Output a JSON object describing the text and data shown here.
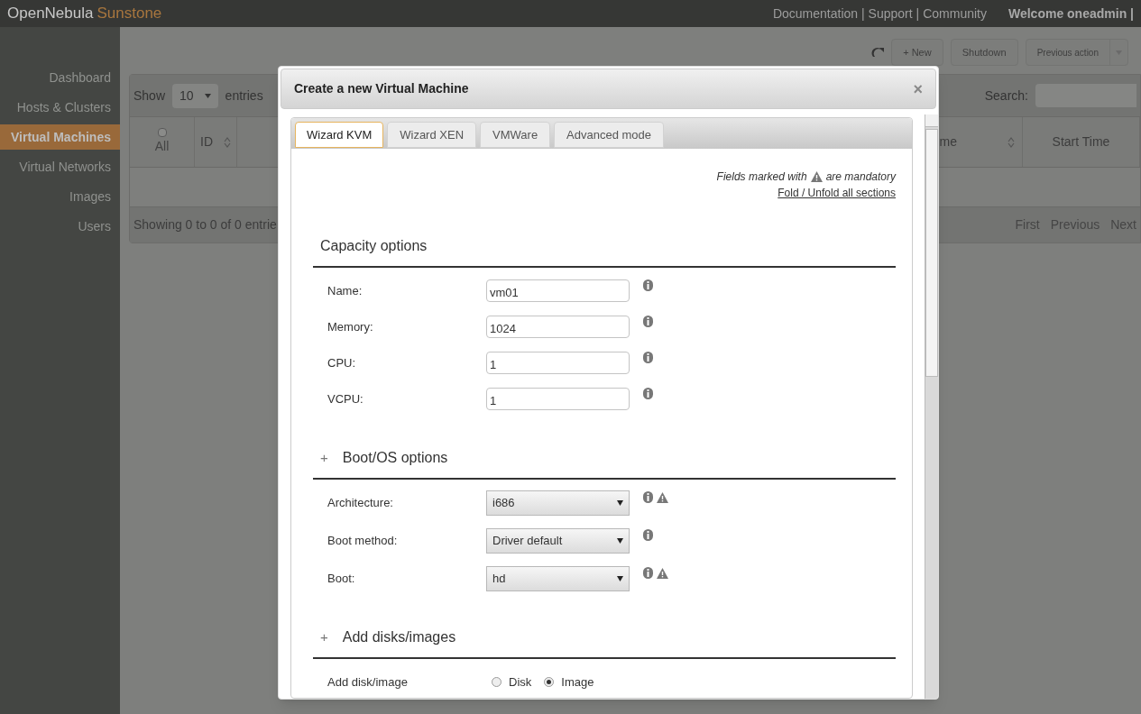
{
  "header": {
    "brand": "OpenNebula",
    "product": "Sunstone",
    "links": [
      "Documentation |",
      "Support |",
      "Community"
    ],
    "welcome": "Welcome oneadmin |"
  },
  "sidebar": {
    "items": [
      {
        "label": "Dashboard",
        "selected": false
      },
      {
        "label": "Hosts & Clusters",
        "selected": false
      },
      {
        "label": "Virtual Machines",
        "selected": true
      },
      {
        "label": "Virtual Networks",
        "selected": false
      },
      {
        "label": "Images",
        "selected": false
      },
      {
        "label": "Users",
        "selected": false
      }
    ]
  },
  "toolbar": {
    "buttons": [
      {
        "label": "+ New",
        "kind": "button"
      },
      {
        "label": "Shutdown",
        "kind": "button"
      },
      {
        "label": "Previous action",
        "kind": "split"
      }
    ]
  },
  "table": {
    "show_label": "Show",
    "length": "10",
    "entries_label": "entries",
    "search_label": "Search:",
    "columns": [
      {
        "label": "All",
        "kind": "checkbox",
        "sortable": false,
        "checked": false
      },
      {
        "label": "ID",
        "kind": "text",
        "sortable": true
      },
      {
        "label": "me",
        "kind": "text",
        "sortable": true
      },
      {
        "label": "Start Time",
        "kind": "text",
        "sortable": false
      }
    ],
    "info": "Showing 0 to 0 of 0 entrie",
    "pagination": [
      "First",
      "Previous",
      "Next"
    ]
  },
  "dialog": {
    "title": "Create a new Virtual Machine",
    "close": "×",
    "tabs": [
      {
        "label": "Wizard KVM",
        "selected": true
      },
      {
        "label": "Wizard XEN",
        "selected": false
      },
      {
        "label": "VMWare",
        "selected": false
      },
      {
        "label": "Advanced mode",
        "selected": false
      }
    ],
    "note_before": "Fields marked with",
    "note_after": "are mandatory",
    "fold_link": "Fold / Unfold all sections",
    "sections": [
      {
        "title": "Capacity options",
        "fields": [
          {
            "kind": "text",
            "label": "Name:",
            "value": "vm01",
            "mandatory": false
          },
          {
            "kind": "text",
            "label": "Memory:",
            "value": "1024",
            "mandatory": false
          },
          {
            "kind": "text",
            "label": "CPU:",
            "value": "1",
            "mandatory": false
          },
          {
            "kind": "text",
            "label": "VCPU:",
            "value": "1",
            "mandatory": false
          }
        ]
      },
      {
        "toggle": "+",
        "title": "Boot/OS options",
        "fields": [
          {
            "kind": "select",
            "label": "Architecture:",
            "value": "i686",
            "mandatory": true
          },
          {
            "kind": "select",
            "label": "Boot method:",
            "value": "Driver default",
            "mandatory": false
          },
          {
            "kind": "select",
            "label": "Boot:",
            "value": "hd",
            "mandatory": true
          }
        ]
      },
      {
        "toggle": "+",
        "title": "Add disks/images",
        "fields": [
          {
            "kind": "radio",
            "label": "Add disk/image",
            "options": [
              {
                "label": "Disk",
                "selected": false
              },
              {
                "label": "Image",
                "selected": true
              }
            ]
          }
        ]
      }
    ]
  }
}
